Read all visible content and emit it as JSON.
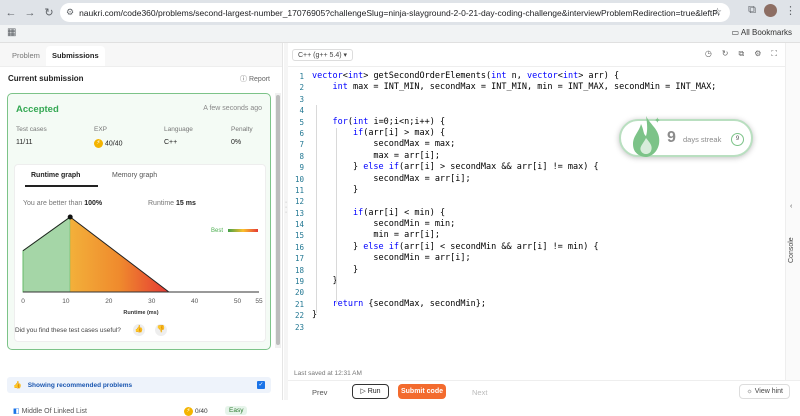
{
  "browser": {
    "url": "naukri.com/code360/problems/second-largest-number_17076905?challengeSlug=ninja-slayground-2-0-21-day-coding-challenge&interviewProblemRedirection=true&leftPanelTabValue=SUB...",
    "bookmarks_label": "All Bookmarks"
  },
  "left": {
    "tabs": [
      "Problem",
      "Submissions"
    ],
    "current_submission": "Current submission",
    "report": "Report",
    "status": "Accepted",
    "time_ago": "A few seconds ago",
    "stats": {
      "test_cases_label": "Test cases",
      "test_cases": "11/11",
      "exp_label": "EXP",
      "exp": "40/40",
      "language_label": "Language",
      "language": "C++",
      "penalty_label": "Penalty",
      "penalty": "0%"
    },
    "graph_tabs": [
      "Runtime graph",
      "Memory graph"
    ],
    "better_than_label": "You are better than",
    "better_than": "100%",
    "runtime_label": "Runtime",
    "runtime": "15 ms",
    "best_label": "Best",
    "axis_label": "Runtime (ms)",
    "ticks": [
      "0",
      "10",
      "20",
      "30",
      "40",
      "50",
      "55"
    ],
    "feedback": "Did you find these test cases useful?",
    "recommended": "Showing recommended problems",
    "next_problem": "Middle Of Linked List",
    "next_problem_exp": "0/40",
    "next_problem_difficulty": "Easy"
  },
  "editor": {
    "language": "C++ (g++ 5.4)",
    "lines": [
      "vector<int> getSecondOrderElements(int n, vector<int> arr) {",
      "    int max = INT_MIN, secondMax = INT_MIN, min = INT_MAX, secondMin = INT_MAX;",
      "",
      "",
      "    for(int i=0;i<n;i++) {",
      "        if(arr[i] > max) {",
      "            secondMax = max;",
      "            max = arr[i];",
      "        } else if(arr[i] > secondMax && arr[i] != max) {",
      "            secondMax = arr[i];",
      "        }",
      "",
      "        if(arr[i] < min) {",
      "            secondMin = min;",
      "            min = arr[i];",
      "        } else if(arr[i] < secondMin && arr[i] != min) {",
      "            secondMin = arr[i];",
      "        }",
      "    }",
      "",
      "    return {secondMax, secondMin};",
      "}",
      ""
    ],
    "line_numbers": [
      "1",
      "2",
      "3",
      "4",
      "5",
      "6",
      "7",
      "8",
      "9",
      "10",
      "11",
      "12",
      "13",
      "14",
      "15",
      "16",
      "17",
      "18",
      "19",
      "20",
      "21",
      "22",
      "23"
    ],
    "last_saved": "Last saved at 12:31 AM",
    "streak_number": "9",
    "streak_label": "days streak",
    "streak_badge": "9"
  },
  "console_label": "Console",
  "bottom": {
    "prev": "Prev",
    "run": "Run",
    "submit": "Submit code",
    "next": "Next",
    "hint": "View hint"
  },
  "chart_data": {
    "type": "area",
    "xlabel": "Runtime (ms)",
    "x_ticks": [
      0,
      10,
      20,
      30,
      40,
      50,
      55
    ],
    "xlim": [
      0,
      55
    ],
    "series": [
      {
        "x": [
          0,
          11,
          34
        ],
        "y": [
          0.55,
          1.0,
          0
        ]
      }
    ],
    "marker": {
      "x": 11,
      "y": 1.0
    }
  }
}
